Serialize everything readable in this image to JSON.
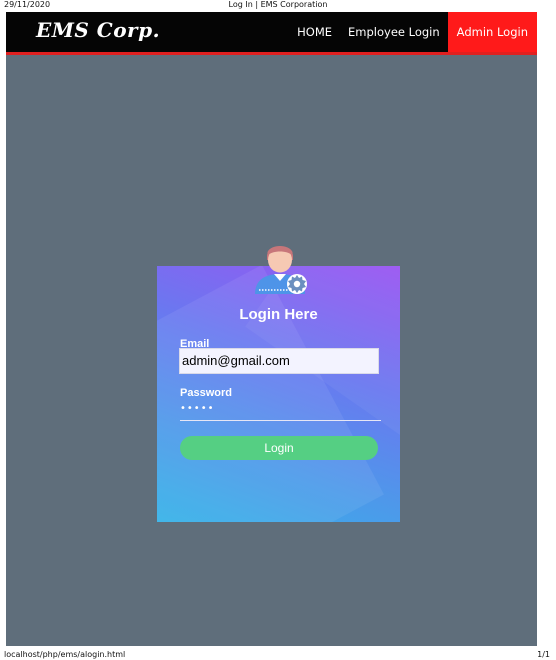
{
  "print": {
    "date": "29/11/2020",
    "title": "Log In | EMS Corporation",
    "url": "localhost/php/ems/alogin.html",
    "page": "1/1"
  },
  "navbar": {
    "brand": "EMS Corp.",
    "links": [
      {
        "label": "HOME"
      },
      {
        "label": "Employee Login"
      },
      {
        "label": "Admin Login",
        "active": true
      }
    ],
    "active_color": "#ff1a1a",
    "underline_color": "#e02020"
  },
  "login_card": {
    "icon": "admin-user-gear-icon",
    "title": "Login Here",
    "email_label": "Email",
    "email_value": "admin@gmail.com",
    "password_label": "Password",
    "password_value": "•••••",
    "button_label": "Login",
    "button_color": "#55cf83"
  },
  "colors": {
    "page_background": "#5f6e7b",
    "navbar_background": "#050505"
  }
}
